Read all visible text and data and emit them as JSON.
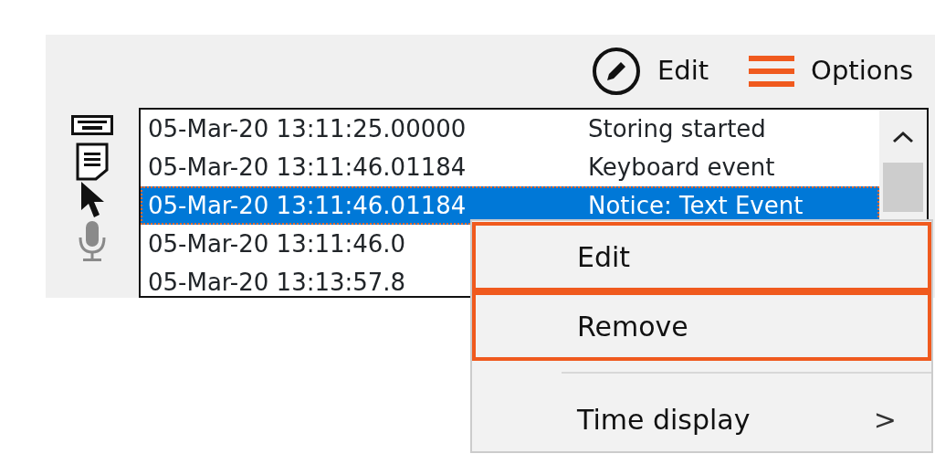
{
  "toolbar": [
    {
      "kind": "edit",
      "label": "Edit"
    },
    {
      "kind": "options",
      "label": "Options"
    }
  ],
  "tools": [
    {
      "kind": "keyboard",
      "disabled": false
    },
    {
      "kind": "note",
      "disabled": false
    },
    {
      "kind": "pointer",
      "disabled": false
    },
    {
      "kind": "microphone",
      "disabled": true
    }
  ],
  "log": {
    "rows": [
      {
        "time": "05-Mar-20 13:11:25.00000",
        "event": "Storing started",
        "selected": false
      },
      {
        "time": "05-Mar-20 13:11:46.01184",
        "event": "Keyboard event",
        "selected": false
      },
      {
        "time": "05-Mar-20 13:11:46.01184",
        "event": "Notice: Text Event",
        "selected": true
      },
      {
        "time": "05-Mar-20 13:11:46.0",
        "selected": false
      },
      {
        "time": "05-Mar-20 13:13:57.8",
        "selected": false
      }
    ]
  },
  "context_menu": {
    "items": [
      {
        "kind": "item",
        "label": "Edit",
        "highlighted": true
      },
      {
        "kind": "item",
        "label": "Remove",
        "highlighted": true
      },
      {
        "kind": "separator"
      },
      {
        "kind": "submenu",
        "label": "Time display",
        "arrow": ">",
        "highlighted": false
      }
    ]
  }
}
